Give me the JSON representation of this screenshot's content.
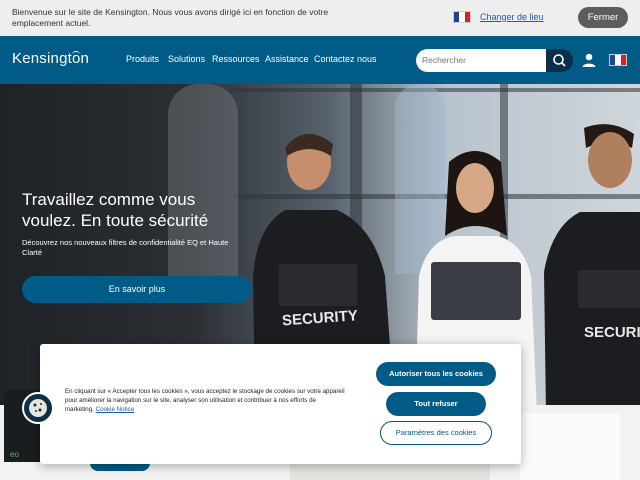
{
  "locale_banner": {
    "message": "Bienvenue sur le site de Kensington. Nous vous avons dirigé ici en fonction de votre emplacement actuel.",
    "change_link": "Changer de lieu",
    "close_label": "Fermer"
  },
  "header": {
    "logo": "Kensington",
    "nav": [
      "Produits",
      "Solutions",
      "Ressources",
      "Assistance",
      "Contactez nous"
    ],
    "search_placeholder": "Rechercher"
  },
  "hero": {
    "title": "Travaillez comme vous voulez. En toute sécurité",
    "subtitle": "Découvrez nos nouveaux filtres de confidentialité EQ et Haute Clarté",
    "cta": "En savoir plus",
    "vest_label_1": "SECURITY",
    "vest_label_2": "SECURITY"
  },
  "cookie_banner": {
    "text": "En cliquant sur « Accepter tous les cookies », vous acceptez le stockage de cookies sur votre appareil pour améliorer la navigation sur le site, analyser son utilisation et contribuer à nos efforts de marketing.",
    "notice_link": "Cookie Notice",
    "accept_all": "Autoriser tous les cookies",
    "refuse_all": "Tout refuser",
    "settings": "Paramètres des cookies"
  },
  "colors": {
    "brand": "#005b87",
    "dark": "#0a2f4a"
  }
}
